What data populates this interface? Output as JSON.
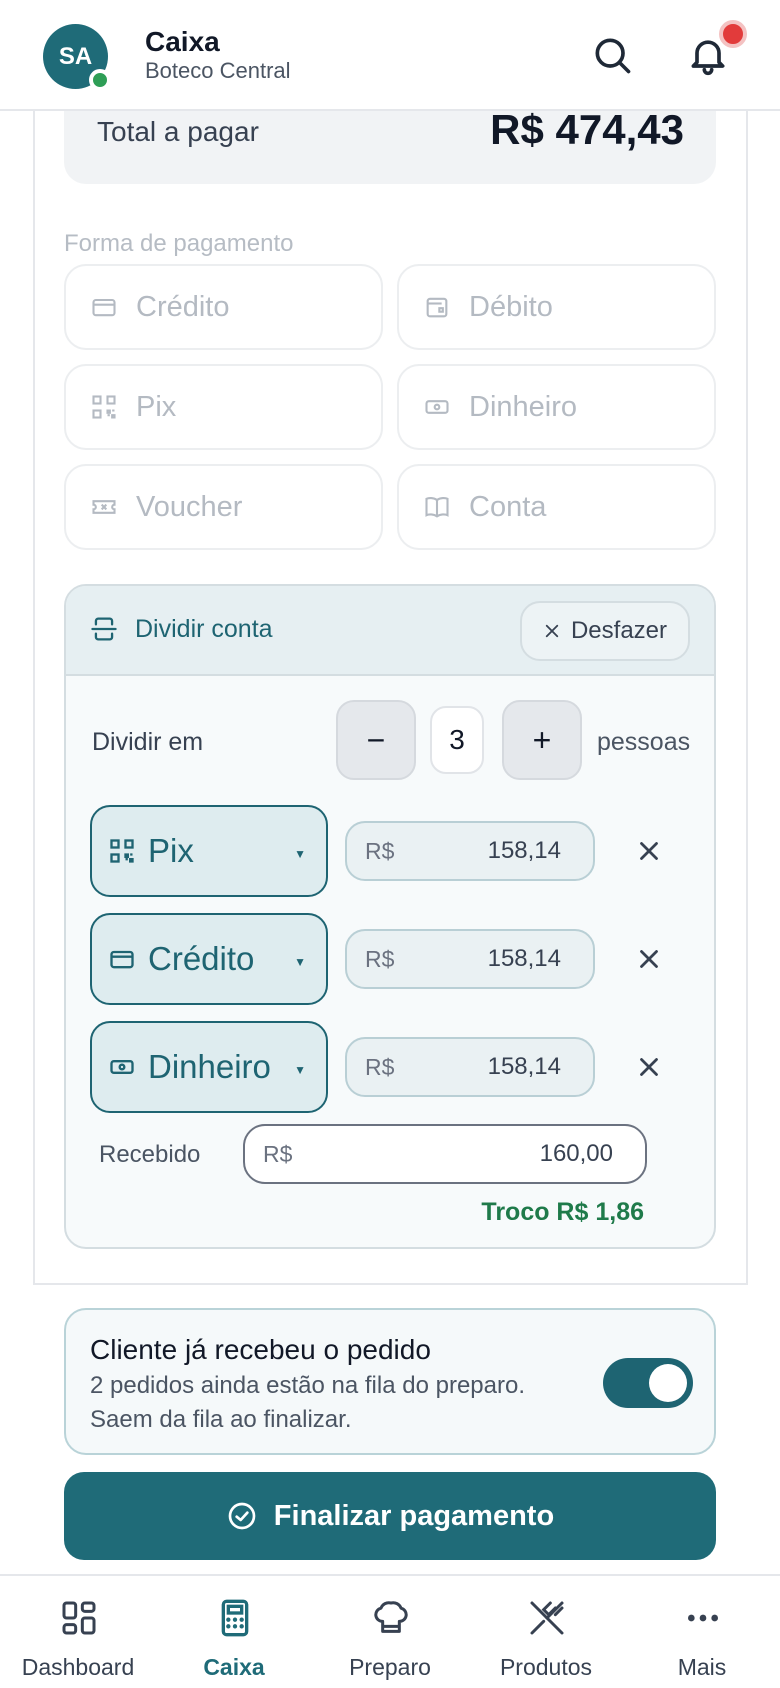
{
  "header": {
    "avatar_initials": "SA",
    "title": "Caixa",
    "subtitle": "Boteco Central",
    "icons": [
      "search-icon",
      "bell-icon"
    ]
  },
  "total": {
    "label": "Total a pagar",
    "value": "R$ 474,43"
  },
  "payment": {
    "section_label": "Forma de pagamento",
    "methods": [
      {
        "label": "Crédito",
        "icon": "credit-card-icon"
      },
      {
        "label": "Débito",
        "icon": "wallet-icon"
      },
      {
        "label": "Pix",
        "icon": "qr-code-icon"
      },
      {
        "label": "Dinheiro",
        "icon": "cash-icon"
      },
      {
        "label": "Voucher",
        "icon": "ticket-icon"
      },
      {
        "label": "Conta",
        "icon": "book-icon"
      }
    ]
  },
  "split": {
    "title": "Dividir conta",
    "undo_label": "Desfazer",
    "divide_label": "Dividir em",
    "minus": "−",
    "plus": "+",
    "count": "3",
    "people_label": "pessoas",
    "rows": [
      {
        "method": "Pix",
        "currency": "R$",
        "amount": "158,14"
      },
      {
        "method": "Crédito",
        "currency": "R$",
        "amount": "158,14"
      },
      {
        "method": "Dinheiro",
        "currency": "R$",
        "amount": "158,14"
      }
    ],
    "received_label": "Recebido",
    "received_currency": "R$",
    "received_value": "160,00",
    "change_text": "Troco R$ 1,86"
  },
  "delivered": {
    "title": "Cliente já recebeu o pedido",
    "line1": "2 pedidos ainda estão na fila do preparo.",
    "line2": "Saem da fila ao finalizar.",
    "toggle_on": true
  },
  "finalize_label": "Finalizar pagamento",
  "nav": [
    {
      "label": "Dashboard",
      "active": false
    },
    {
      "label": "Caixa",
      "active": true
    },
    {
      "label": "Preparo",
      "active": false
    },
    {
      "label": "Produtos",
      "active": false
    },
    {
      "label": "Mais",
      "active": false
    }
  ],
  "colors": {
    "primary": "#1f6b78",
    "success": "#1f7a4a",
    "alert": "#e23b3b"
  }
}
